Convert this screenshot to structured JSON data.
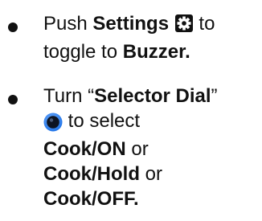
{
  "items": [
    {
      "segments": {
        "t1": "Push ",
        "b1": "Settings",
        "t2": " to toggle to ",
        "b2": "Buzzer."
      },
      "icon": "settings-gear-icon"
    },
    {
      "segments": {
        "t1": "Turn “",
        "b1": "Selector Dial",
        "t2": "”",
        "t3": " to select ",
        "b2": "Cook/ON",
        "t4": " or ",
        "b3": "Cook/Hold",
        "t5": " or ",
        "b4": "Cook/OFF."
      },
      "icon": "selector-dial-icon"
    }
  ],
  "colors": {
    "text": "#111111",
    "dial": "#1e73e8",
    "icon_box": "#111111"
  }
}
